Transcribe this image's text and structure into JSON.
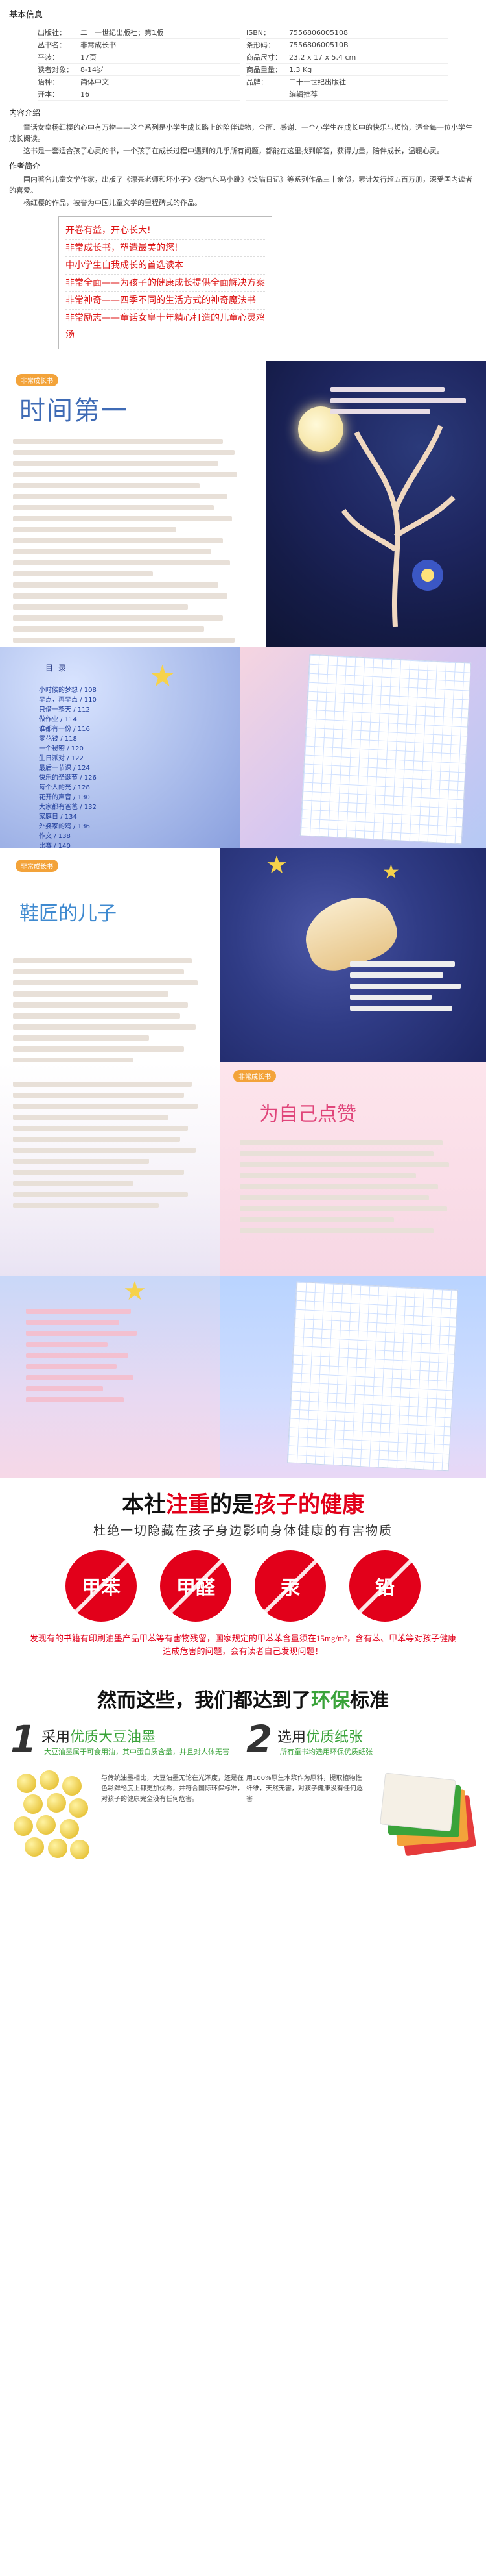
{
  "info": {
    "heading": "基本信息",
    "rows": [
      {
        "k": "出版社：",
        "v": "二十一世纪出版社；第1版"
      },
      {
        "k": "ISBN：",
        "v": "7556806005108"
      },
      {
        "k": "丛书名：",
        "v": "非常成长书"
      },
      {
        "k": "条形码：",
        "v": "755680600510B"
      },
      {
        "k": "平装：",
        "v": "17页"
      },
      {
        "k": "商品尺寸：",
        "v": "23.2 x 17 x 5.4 cm"
      },
      {
        "k": "读者对象：",
        "v": "8-14岁"
      },
      {
        "k": "商品重量：",
        "v": "1.3 Kg"
      },
      {
        "k": "语种：",
        "v": "简体中文"
      },
      {
        "k": "品牌：",
        "v": "二十一世纪出版社"
      },
      {
        "k": "开本：",
        "v": "16"
      },
      {
        "k": "",
        "v": "编辑推荐"
      }
    ]
  },
  "intro": {
    "heading": "内容介绍",
    "p1": "童话女皇杨红樱的心中有万物——这个系列是小学生成长路上的陪伴读物，全面、感谢、一个小学生在成长中的快乐与烦恼，适合每一位小学生成长阅读。",
    "p2": "这书是一套适合孩子心灵的书，一个孩子在成长过程中遇到的几乎所有问题，都能在这里找到解答，获得力量，陪伴成长，温暖心灵。",
    "author_heading": "作者简介",
    "p3": "国内著名儿童文学作家，出版了《漂亮老师和坏小子》《淘气包马小跳》《笑猫日记》等系列作品三十余部，累计发行超五百万册，深受国内读者的喜爱。",
    "p4": "杨红樱的作品，被誉为中国儿童文学的里程碑式的作品。"
  },
  "highlights": [
    "开卷有益，开心长大!",
    "非常成长书，塑造最美的您!",
    "中小学生自我成长的首选读本",
    "非常全面——为孩子的健康成长提供全面解决方案",
    "非常神奇——四季不同的生活方式的神奇魔法书",
    "非常励志——童话女皇十年精心打造的儿童心灵鸡汤"
  ],
  "panel1": {
    "badge": "非常成长书",
    "title": "时间第一"
  },
  "panel2": {
    "toc_title": "目 录",
    "toc": [
      "小时候的梦想 / 108",
      "早点，再早点 / 110",
      "只借一整天 / 112",
      "做作业 / 114",
      "谁都有一份 / 116",
      "零花钱 / 118",
      "一个秘密 / 120",
      "生日派对 / 122",
      "最后一节课 / 124",
      "快乐的圣诞节 / 126",
      "每个人的光 / 128",
      "花开的声音 / 130",
      "大家都有爸爸 / 132",
      "家庭日 / 134",
      "外婆家的鸡 / 136",
      "作文 / 138",
      "比赛 / 140"
    ]
  },
  "panel3": {
    "badge": "非常成长书",
    "title": "鞋匠的儿子"
  },
  "panel4": {
    "badge": "非常成长书",
    "title": "为自己点赞"
  },
  "promo": {
    "title_a": "本社",
    "title_b": "注重",
    "title_c": "的是",
    "title_d": "孩子的健康",
    "subtitle": "杜绝一切隐藏在孩子身边影响身体健康的有害物质",
    "chems": [
      "甲苯",
      "甲醛",
      "汞",
      "铅"
    ],
    "note": "发现有的书籍有印刷油墨产品甲苯等有害物残留，国家规定的甲苯苯含量须在15mg/m²，含有苯、甲苯等对孩子健康造成危害的问题，会有读者自己发现问题！",
    "mid_a": "然而这些，我们都达到了",
    "mid_b": "环保",
    "mid_c": "标准",
    "col1_num": "1",
    "col1_h_a": "采用",
    "col1_h_b": "优质大豆油墨",
    "col1_d": "大豆油墨属于可食用油，其中蛋白质含量，并且对人体无害",
    "col1_txt": "与传统油墨相比，大豆油墨无论在光泽度，还是在色彩鲜艳度上都更加优秀，并符合国际环保标准，对孩子的健康完全没有任何危害。",
    "col2_num": "2",
    "col2_h_a": "选用",
    "col2_h_b": "优质纸张",
    "col2_d": "所有童书均选用环保优质纸张",
    "col2_txt": "用100%原生木浆作为原料，提取植物性纤维，天然无害，对孩子健康没有任何危害"
  },
  "colors": {
    "red": "#e2001a",
    "green": "#3aa33a",
    "blue": "#3f6bb5"
  }
}
